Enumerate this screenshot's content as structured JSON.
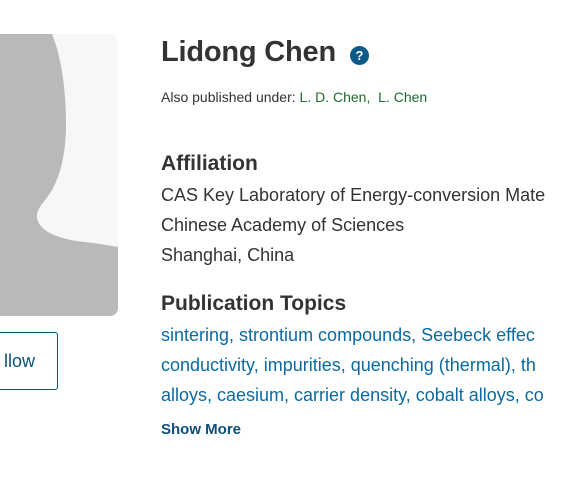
{
  "profile": {
    "name": "Lidong Chen",
    "also_published_label": "Also published under:",
    "aliases": [
      "L. D. Chen,",
      "L. Chen"
    ]
  },
  "follow_button": {
    "label": "llow"
  },
  "affiliation": {
    "title": "Affiliation",
    "lines": [
      "CAS Key Laboratory of Energy-conversion Mate",
      "Chinese Academy of Sciences",
      "Shanghai, China"
    ]
  },
  "topics": {
    "title": "Publication Topics",
    "lines": [
      "sintering, strontium compounds, Seebeck effec",
      "conductivity, impurities, quenching (thermal), th",
      "alloys, caesium, carrier density, cobalt alloys, co"
    ],
    "show_more_label": "Show More"
  },
  "colors": {
    "link_blue": "#0b6aa2",
    "dark_blue": "#0b4f7a",
    "alias_green": "#1f6b2e",
    "avatar_gray": "#b9b9b9"
  },
  "icons": {
    "help": "question-circle-icon",
    "avatar": "person-silhouette-icon"
  }
}
